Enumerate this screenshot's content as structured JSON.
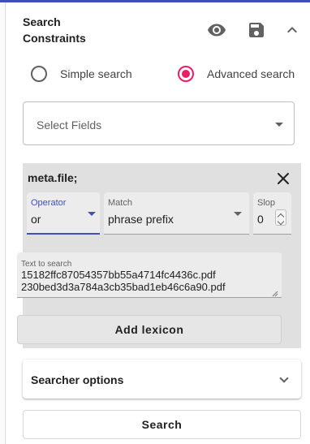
{
  "header": {
    "title_line1": "Search",
    "title_line2": "Constraints",
    "icons": [
      "eye-icon",
      "save-icon",
      "chevron-up-icon"
    ]
  },
  "search_mode": {
    "options": [
      {
        "label": "Simple search",
        "selected": false
      },
      {
        "label": "Advanced search",
        "selected": true
      }
    ],
    "accent_color": "#e91e63"
  },
  "select_fields": {
    "placeholder": "Select Fields"
  },
  "constraint": {
    "field": "meta.file;",
    "operator": {
      "label": "Operator",
      "value": "or"
    },
    "match": {
      "label": "Match",
      "value": "phrase prefix"
    },
    "slop": {
      "label": "Slop",
      "value": "0"
    },
    "text": {
      "label": "Text to search",
      "value": "15182ffc87054357bb55a4714fc4436c.pdf\n230bed3d3a784a3cb35bad1eb46c6a90.pdf"
    },
    "add_button": "Add lexicon"
  },
  "searcher_options": {
    "label": "Searcher options"
  },
  "search_button": "Search",
  "colors": {
    "primary": "#3f51b5",
    "accent": "#e91e63"
  }
}
